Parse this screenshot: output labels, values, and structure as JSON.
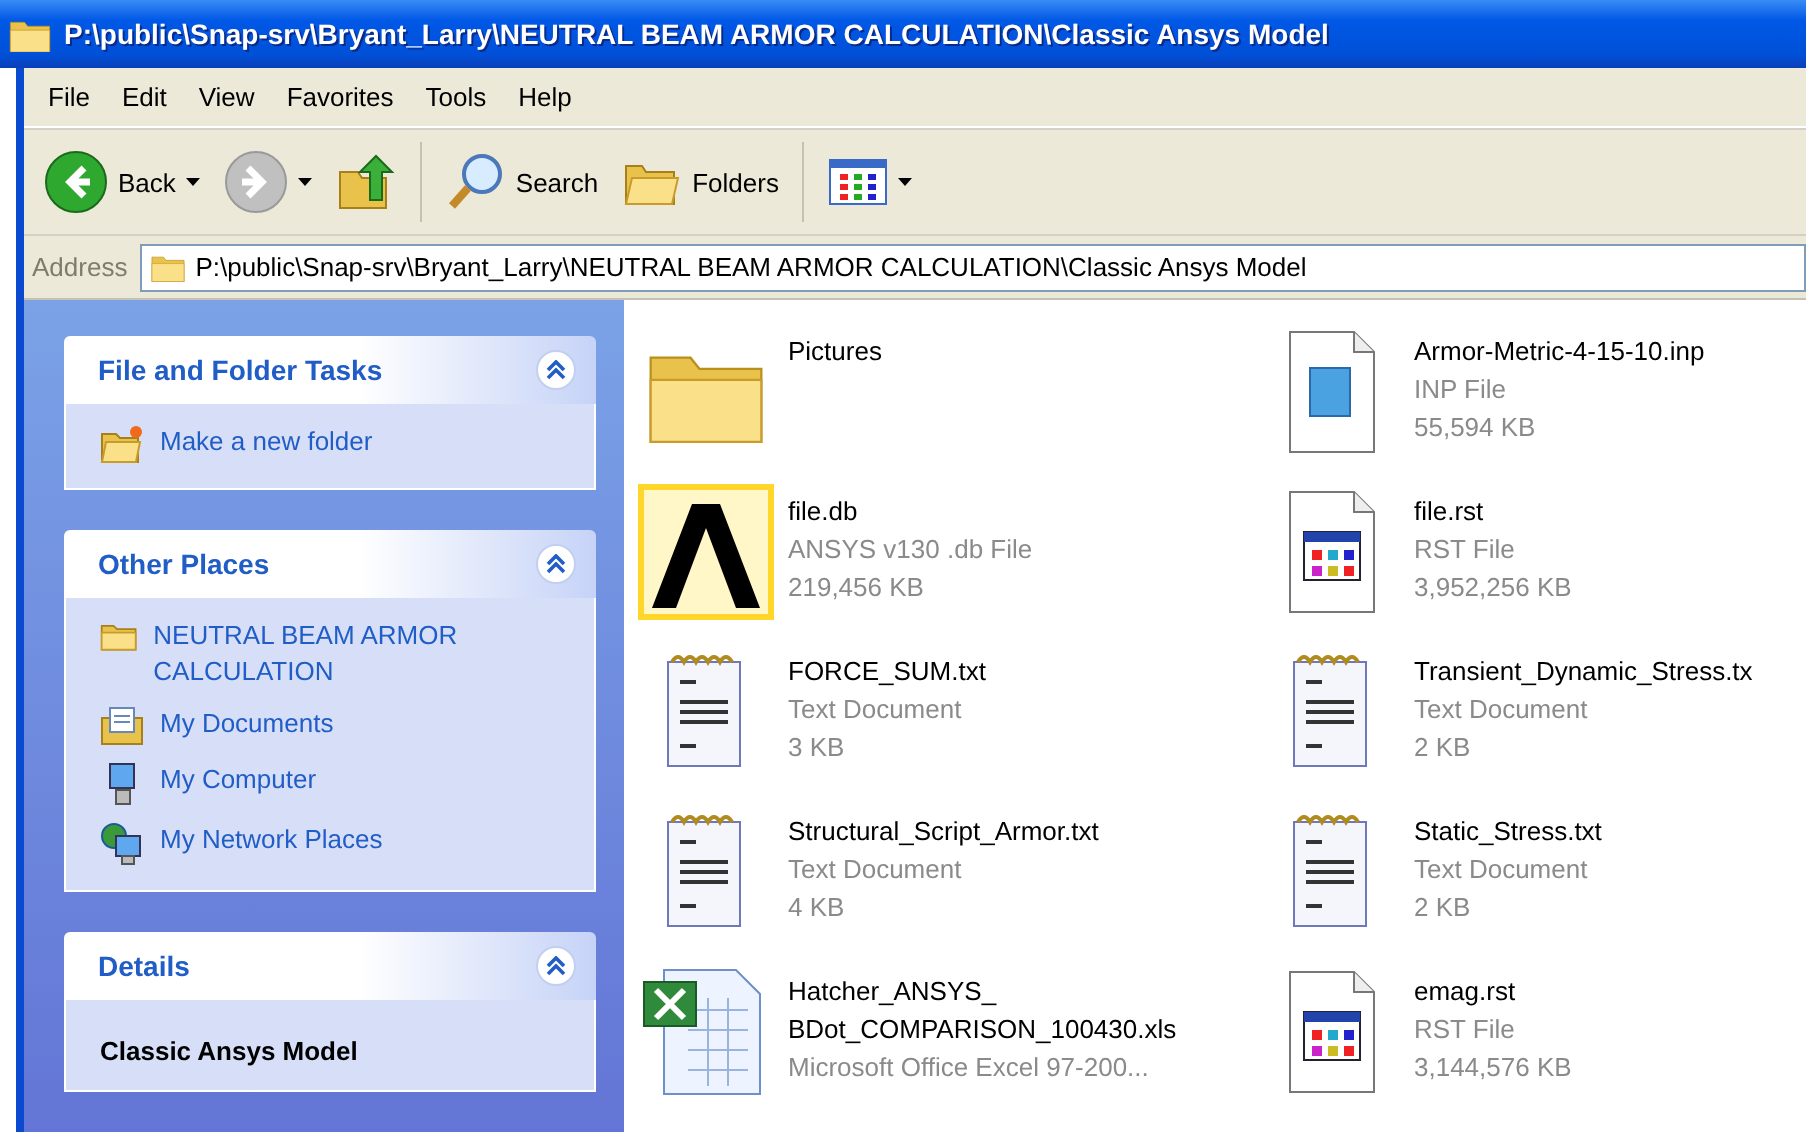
{
  "window": {
    "title": "P:\\public\\Snap-srv\\Bryant_Larry\\NEUTRAL BEAM ARMOR CALCULATION\\Classic Ansys Model"
  },
  "menu": [
    "File",
    "Edit",
    "View",
    "Favorites",
    "Tools",
    "Help"
  ],
  "toolbar": [
    {
      "kind": "back",
      "label": "Back",
      "disabled": false
    },
    {
      "kind": "forward",
      "disabled": true
    },
    {
      "kind": "up"
    },
    {
      "kind": "search",
      "label": "Search"
    },
    {
      "kind": "folders",
      "label": "Folders"
    },
    {
      "kind": "views"
    }
  ],
  "address": {
    "label": "Address",
    "value": "P:\\public\\Snap-srv\\Bryant_Larry\\NEUTRAL BEAM ARMOR CALCULATION\\Classic Ansys Model"
  },
  "sidebar": [
    {
      "title": "File and Folder Tasks",
      "expanded": true,
      "links": [
        {
          "kind": "newfolder",
          "label": "Make a new folder"
        }
      ]
    },
    {
      "title": "Other Places",
      "expanded": true,
      "links": [
        {
          "kind": "folder",
          "label": "NEUTRAL BEAM ARMOR CALCULATION"
        },
        {
          "kind": "documents",
          "label": "My Documents"
        },
        {
          "kind": "computer",
          "label": "My Computer"
        },
        {
          "kind": "network",
          "label": "My Network Places"
        }
      ]
    },
    {
      "title": "Details",
      "expanded": true,
      "heading": "Classic Ansys Model"
    }
  ],
  "items": [
    {
      "kind": "folder",
      "name": [
        "Pictures"
      ]
    },
    {
      "kind": "inp",
      "name": [
        "Armor-Metric-4-15-10.inp"
      ],
      "type": "INP File",
      "size": "55,594 KB"
    },
    {
      "kind": "ansys",
      "name": [
        "file.db"
      ],
      "type": "ANSYS v130 .db File",
      "size": "219,456 KB"
    },
    {
      "kind": "rst",
      "name": [
        "file.rst"
      ],
      "type": "RST File",
      "size": "3,952,256 KB"
    },
    {
      "kind": "text",
      "name": [
        "FORCE_SUM.txt"
      ],
      "type": "Text Document",
      "size": "3 KB"
    },
    {
      "kind": "text",
      "name": [
        "Transient_Dynamic_Stress.tx"
      ],
      "type": "Text Document",
      "size": "2 KB"
    },
    {
      "kind": "text",
      "name": [
        "Structural_Script_Armor.txt"
      ],
      "type": "Text Document",
      "size": "4 KB"
    },
    {
      "kind": "text",
      "name": [
        "Static_Stress.txt"
      ],
      "type": "Text Document",
      "size": "2 KB"
    },
    {
      "kind": "excel",
      "name": [
        "Hatcher_ANSYS_",
        "BDot_COMPARISON_100430.xls"
      ],
      "type": "Microsoft Office Excel 97-200..."
    },
    {
      "kind": "rst",
      "name": [
        "emag.rst"
      ],
      "type": "RST File",
      "size": "3,144,576 KB"
    }
  ]
}
